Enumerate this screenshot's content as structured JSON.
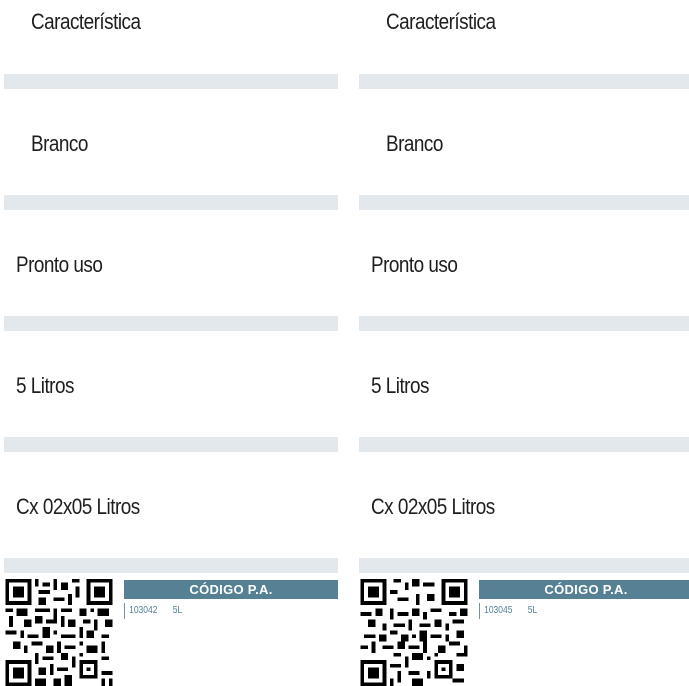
{
  "columns": [
    {
      "rows": [
        "Característica",
        "Branco",
        "Pronto uso",
        "5 Litros",
        "Cx 02x05 Litros"
      ],
      "code_header": "CÓDIGO P.A.",
      "code": "103042",
      "volume": "5L"
    },
    {
      "rows": [
        "Característica",
        "Branco",
        "Pronto uso",
        "5 Litros",
        "Cx 02x05 Litros"
      ],
      "code_header": "CÓDIGO P.A.",
      "code": "103045",
      "volume": "5L"
    }
  ],
  "colors": {
    "band": "#e3e8ec",
    "header": "#568195"
  }
}
